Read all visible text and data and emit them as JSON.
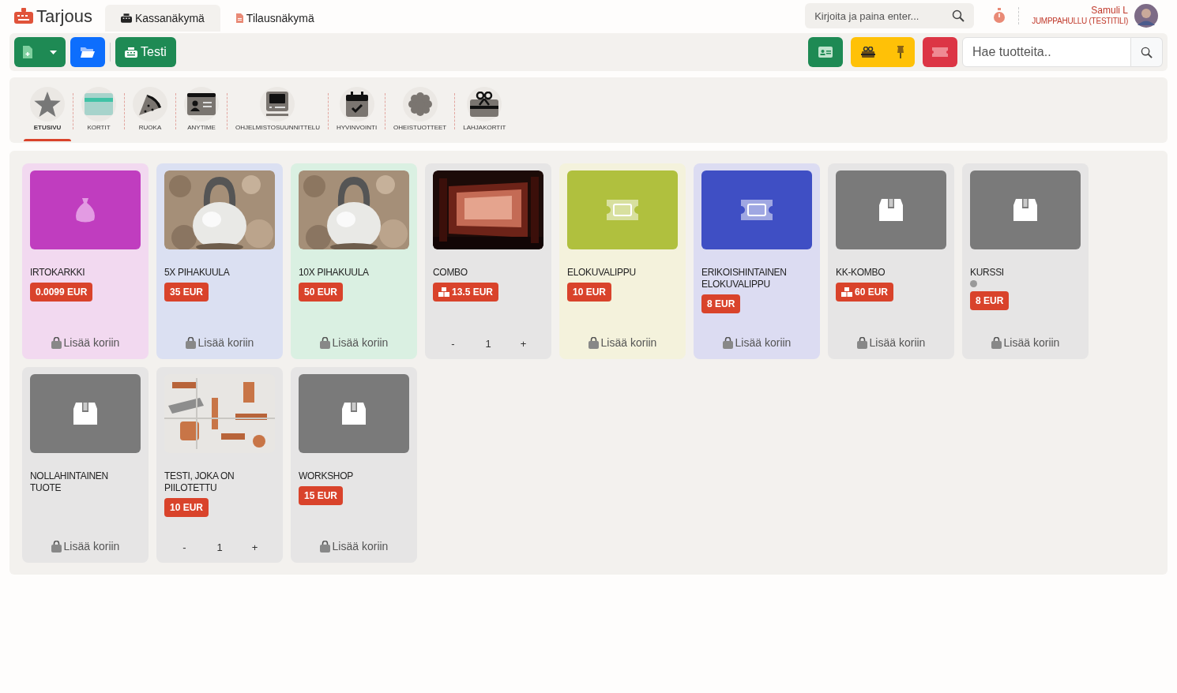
{
  "app": {
    "title": "Tarjous"
  },
  "tabs": [
    {
      "label": "Kassanäkymä",
      "selected": true,
      "kind": "register"
    },
    {
      "label": "Tilausnäkymä",
      "selected": false,
      "kind": "document"
    }
  ],
  "header": {
    "search": {
      "placeholder": "Kirjoita ja paina enter..."
    },
    "user": {
      "name": "Samuli L",
      "role": "JUMPPAHULLU (TESTITILI)"
    }
  },
  "toolbar": {
    "register_button": "Testi",
    "product_search": {
      "placeholder": "Hae tuotteita.."
    }
  },
  "categories": [
    {
      "label": "ETUSIVU",
      "selected": true,
      "kind": "star"
    },
    {
      "label": "KORTIT",
      "selected": false,
      "kind": "card"
    },
    {
      "label": "RUOKA",
      "selected": false,
      "kind": "pizza"
    },
    {
      "label": "ANYTIME",
      "selected": false,
      "kind": "idcard"
    },
    {
      "label": "OHJELMISTOSUUNNITTELU",
      "selected": false,
      "kind": "computer"
    },
    {
      "label": "HYVINVOINTI",
      "selected": false,
      "kind": "calendar"
    },
    {
      "label": "OHEISTUOTTEET",
      "selected": false,
      "kind": "flower"
    },
    {
      "label": "LAHJAKORTIT",
      "selected": false,
      "kind": "gift"
    }
  ],
  "products": [
    {
      "name": "IRTOKARKKI",
      "price": "0.0099 EUR",
      "color": "#f2d9f0",
      "image": {
        "kind": "bag",
        "color": "#c03dbf"
      },
      "footer": {
        "kind": "add",
        "label": "Lisää koriin"
      }
    },
    {
      "name": "5X PIHAKUULA",
      "price": "35 EUR",
      "color": "#dbe0f2",
      "image": {
        "kind": "kettlebell"
      },
      "footer": {
        "kind": "add",
        "label": "Lisää koriin"
      }
    },
    {
      "name": "10X PIHAKUULA",
      "price": "50 EUR",
      "color": "#daf0e2",
      "image": {
        "kind": "kettlebell"
      },
      "footer": {
        "kind": "add",
        "label": "Lisää koriin"
      }
    },
    {
      "name": "COMBO",
      "price": "13.5 EUR",
      "bundle": true,
      "color": "#e6e5e5",
      "image": {
        "kind": "room"
      },
      "footer": {
        "kind": "stepper",
        "minus": "-",
        "quantity": "1",
        "plus": "+"
      }
    },
    {
      "name": "ELOKUVALIPPU",
      "price": "10 EUR",
      "color": "#f4f2dc",
      "image": {
        "kind": "ticket",
        "color": "#b0c03e"
      },
      "footer": {
        "kind": "add",
        "label": "Lisää koriin"
      }
    },
    {
      "name": "ERIKOISHINTAINEN ELOKUVALIPPU",
      "price": "8 EUR",
      "color": "#dcdcf2",
      "image": {
        "kind": "ticket",
        "color": "#3f4fc4"
      },
      "footer": {
        "kind": "add",
        "label": "Lisää koriin"
      }
    },
    {
      "name": "KK-KOMBO",
      "price": "60 EUR",
      "bundle": true,
      "color": "#e6e5e5",
      "image": {
        "kind": "box",
        "color": "#7a7a7a"
      },
      "footer": {
        "kind": "add",
        "label": "Lisää koriin"
      }
    },
    {
      "name": "KURSSI",
      "price": "8 EUR",
      "marker": true,
      "color": "#e6e5e5",
      "image": {
        "kind": "box",
        "color": "#7a7a7a"
      },
      "footer": {
        "kind": "add",
        "label": "Lisää koriin"
      }
    },
    {
      "name": "NOLLAHINTAINEN TUOTE",
      "color": "#e6e5e5",
      "image": {
        "kind": "box",
        "color": "#7a7a7a"
      },
      "footer": {
        "kind": "add",
        "label": "Lisää koriin"
      }
    },
    {
      "name": "TESTI, JOKA ON PIILOTETTU",
      "price": "10 EUR",
      "color": "#e6e5e5",
      "image": {
        "kind": "pipes"
      },
      "footer": {
        "kind": "stepper",
        "minus": "-",
        "quantity": "1",
        "plus": "+"
      }
    },
    {
      "name": "WORKSHOP",
      "price": "15 EUR",
      "color": "#e6e5e5",
      "image": {
        "kind": "box",
        "color": "#7a7a7a"
      },
      "footer": {
        "kind": "add",
        "label": "Lisää koriin"
      }
    }
  ]
}
